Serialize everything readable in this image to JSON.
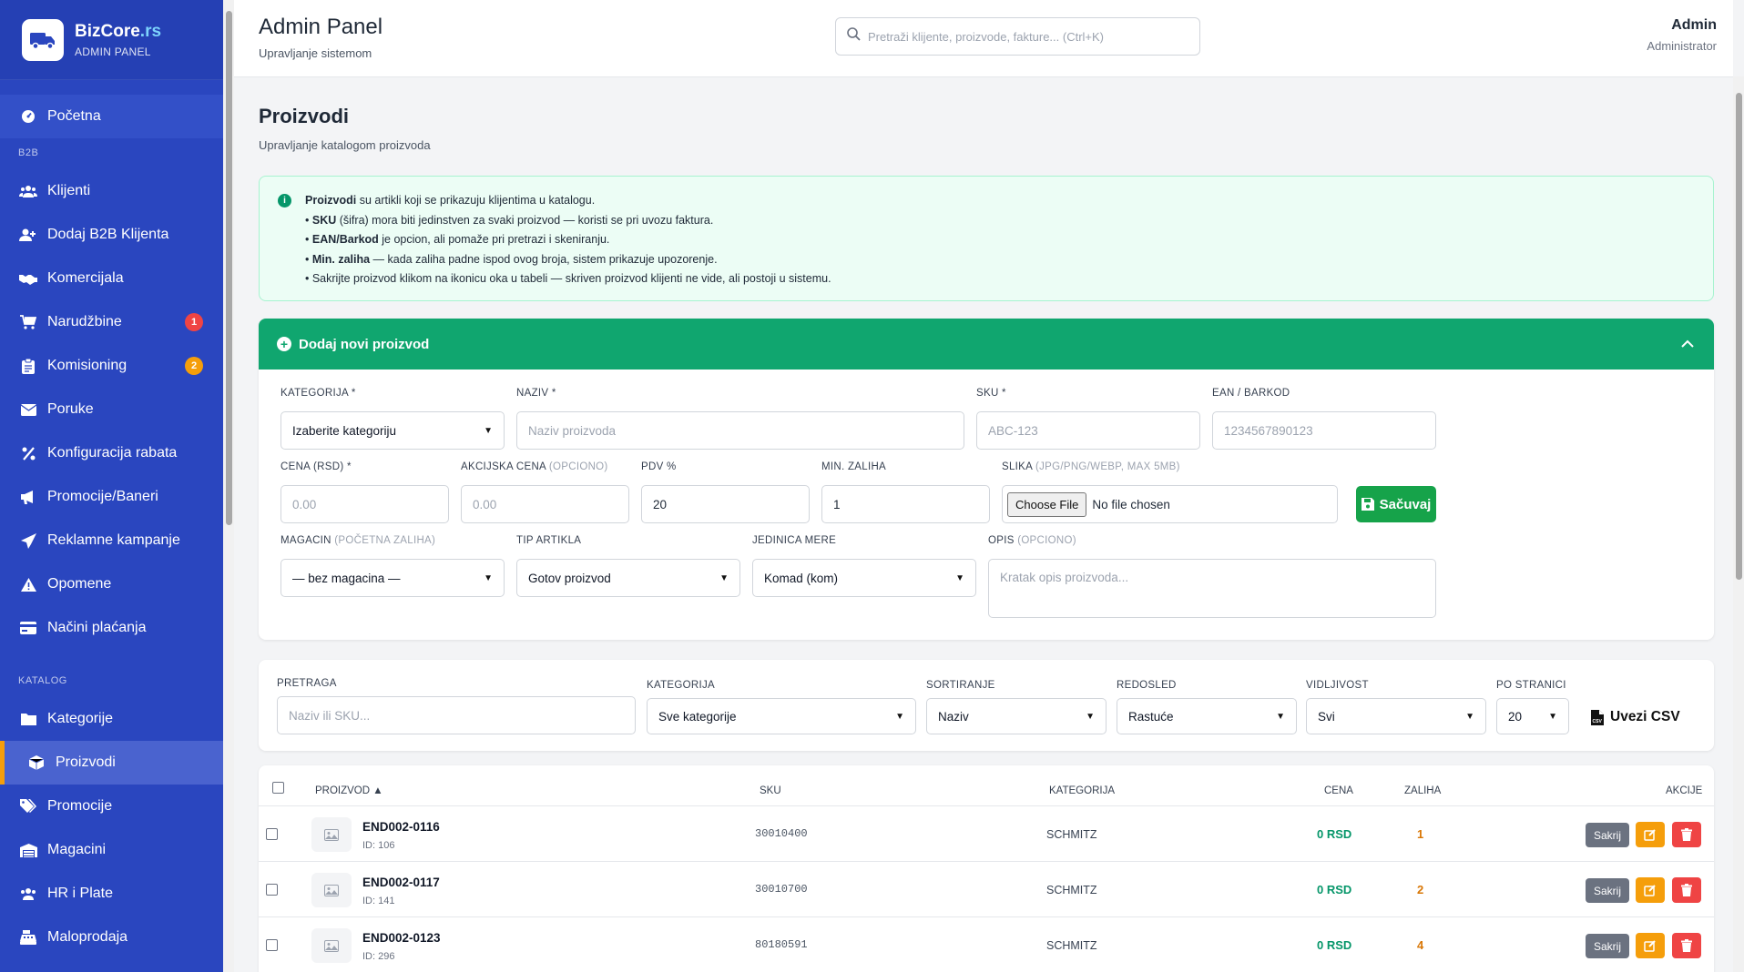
{
  "brand": {
    "name": "BizCore",
    "tld": ".rs",
    "subtitle": "ADMIN PANEL"
  },
  "sidebar": {
    "home": "Početna",
    "section_b2b": "B2B",
    "b2b_items": [
      {
        "label": "Klijenti",
        "icon": "users-icon"
      },
      {
        "label": "Dodaj B2B Klijenta",
        "icon": "user-plus-icon"
      },
      {
        "label": "Komercijala",
        "icon": "handshake-icon"
      },
      {
        "label": "Narudžbine",
        "icon": "cart-icon",
        "badge": "1"
      },
      {
        "label": "Komisioning",
        "icon": "clipboard-icon",
        "badge": "2"
      },
      {
        "label": "Poruke",
        "icon": "envelope-icon"
      },
      {
        "label": "Konfiguracija rabata",
        "icon": "percent-icon"
      },
      {
        "label": "Promocije/Baneri",
        "icon": "megaphone-icon"
      },
      {
        "label": "Reklamne kampanje",
        "icon": "paper-plane-icon"
      },
      {
        "label": "Opomene",
        "icon": "warning-icon"
      },
      {
        "label": "Načini plaćanja",
        "icon": "credit-card-icon"
      }
    ],
    "section_katalog": "KATALOG",
    "katalog_items": [
      {
        "label": "Kategorije",
        "icon": "folder-icon"
      },
      {
        "label": "Proizvodi",
        "icon": "box-icon",
        "active": true
      },
      {
        "label": "Promocije",
        "icon": "tags-icon"
      },
      {
        "label": "Magacini",
        "icon": "warehouse-icon"
      },
      {
        "label": "HR i Plate",
        "icon": "users-cog-icon"
      },
      {
        "label": "Maloprodaja",
        "icon": "cash-register-icon"
      }
    ]
  },
  "header": {
    "title": "Admin Panel",
    "subtitle": "Upravljanje sistemom",
    "search_placeholder": "Pretraži klijente, proizvode, fakture... (Ctrl+K)",
    "user_name": "Admin",
    "user_role": "Administrator"
  },
  "page": {
    "title": "Proizvodi",
    "subtitle": "Upravljanje katalogom proizvoda"
  },
  "info": {
    "l1_bold": "Proizvodi",
    "l1_rest": " su artikli koji se prikazuju klijentima u katalogu.",
    "l2_pre": "• ",
    "l2_bold": "SKU",
    "l2_rest": " (šifra) mora biti jedinstven za svaki proizvod — koristi se pri uvozu faktura.",
    "l3_pre": "• ",
    "l3_bold": "EAN/Barkod",
    "l3_rest": " je opcion, ali pomaže pri pretrazi i skeniranju.",
    "l4_pre": "• ",
    "l4_bold": "Min. zaliha",
    "l4_rest": " — kada zaliha padne ispod ovog broja, sistem prikazuje upozorenje.",
    "l5": "• Sakrijte proizvod klikom na ikonicu oka u tabeli — skriven proizvod klijenti ne vide, ali postoji u sistemu."
  },
  "add_form": {
    "header": "Dodaj novi proizvod",
    "kategorija_label": "KATEGORIJA *",
    "kategorija_value": "Izaberite kategoriju",
    "naziv_label": "NAZIV *",
    "naziv_placeholder": "Naziv proizvoda",
    "sku_label": "SKU *",
    "sku_placeholder": "ABC-123",
    "ean_label": "EAN / BARKOD",
    "ean_placeholder": "1234567890123",
    "cena_label": "CENA (RSD) *",
    "cena_placeholder": "0.00",
    "akcijska_label": "AKCIJSKA CENA",
    "akcijska_opt": "(OPCIONO)",
    "akcijska_placeholder": "0.00",
    "pdv_label": "PDV %",
    "pdv_value": "20",
    "minzal_label": "MIN. ZALIHA",
    "minzal_value": "1",
    "slika_label": "SLIKA",
    "slika_opt": "(JPG/PNG/WEBP, MAX 5MB)",
    "file_button": "Choose File",
    "file_status": "No file chosen",
    "save_label": "Sačuvaj",
    "magacin_label": "MAGACIN",
    "magacin_opt": "(POČETNA ZALIHA)",
    "magacin_value": "— bez magacina —",
    "tip_label": "TIP ARTIKLA",
    "tip_value": "Gotov proizvod",
    "jedinica_label": "JEDINICA MERE",
    "jedinica_value": "Komad (kom)",
    "opis_label": "OPIS",
    "opis_opt": "(OPCIONO)",
    "opis_placeholder": "Kratak opis proizvoda..."
  },
  "filters": {
    "pretraga_label": "PRETRAGA",
    "pretraga_placeholder": "Naziv ili SKU...",
    "kategorija_label": "KATEGORIJA",
    "kategorija_value": "Sve kategorije",
    "sort_label": "SORTIRANJE",
    "sort_value": "Naziv",
    "order_label": "REDOSLED",
    "order_value": "Rastuće",
    "vis_label": "VIDLJIVOST",
    "vis_value": "Svi",
    "per_label": "PO STRANICI",
    "per_value": "20",
    "csv_label": "Uvezi CSV"
  },
  "table": {
    "headers": {
      "proizvod": "PROIZVOD ▲",
      "sku": "SKU",
      "kategorija": "KATEGORIJA",
      "cena": "CENA",
      "zaliha": "ZALIHA",
      "akcije": "AKCIJE"
    },
    "hide_label": "Sakrij",
    "rows": [
      {
        "name": "END002-0116",
        "id": "ID: 106",
        "sku": "30010400",
        "category": "SCHMITZ",
        "price": "0 RSD",
        "stock": "1"
      },
      {
        "name": "END002-0117",
        "id": "ID: 141",
        "sku": "30010700",
        "category": "SCHMITZ",
        "price": "0 RSD",
        "stock": "2"
      },
      {
        "name": "END002-0123",
        "id": "ID: 296",
        "sku": "80180591",
        "category": "SCHMITZ",
        "price": "0 RSD",
        "stock": "4"
      }
    ]
  },
  "colors": {
    "sidebar": "#2a46bf",
    "accent_green": "#10a66f",
    "save_green": "#16a34a",
    "badge_red": "#ef4444",
    "badge_orange": "#f59e0b",
    "price_green": "#059669",
    "stock_orange": "#d97706"
  }
}
